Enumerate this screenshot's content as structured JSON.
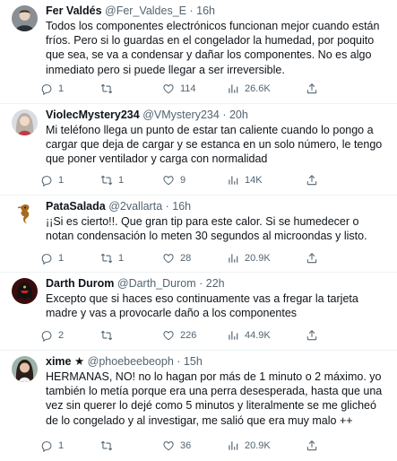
{
  "tweets": [
    {
      "name": "Fer Valdés",
      "handle": "@Fer_Valdes_E",
      "dot": "·",
      "time": "16h",
      "text": "Todos los componentes electrónicos funcionan mejor cuando están fríos. Pero si lo guardas en el congelador la humedad, por poquito que sea, se va a condensar y dañar los componentes. No es algo inmediato pero si puede llegar a ser irreversible.",
      "replies": "1",
      "retweets": "",
      "likes": "114",
      "views": "26.6K",
      "avatar_icon": "avatar-man-icon"
    },
    {
      "name": "ViolecMystery234",
      "handle": "@VMystery234",
      "dot": "·",
      "time": "20h",
      "text": "Mi teléfono llega un punto de estar tan caliente cuando lo pongo a cargar que deja de cargar y se estanca en un solo número, le tengo que poner ventilador y carga con normalidad",
      "replies": "1",
      "retweets": "1",
      "likes": "9",
      "views": "14K",
      "avatar_icon": "avatar-woman-icon"
    },
    {
      "name": "PataSalada",
      "handle": "@2vallarta",
      "dot": "·",
      "time": "16h",
      "text": "¡¡Si es cierto!!. Que gran tip para este calor. Si se humedecer o notan condensación lo meten 30 segundos al microondas y listo.",
      "replies": "1",
      "retweets": "1",
      "likes": "28",
      "views": "20.9K",
      "avatar_icon": "avatar-seahorse-icon"
    },
    {
      "name": "Darth Durom",
      "handle": "@Darth_Durom",
      "dot": "·",
      "time": "22h",
      "text": "Excepto que si haces eso continuamente vas a fregar la tarjeta madre y vas a provocarle daño a los componentes",
      "replies": "2",
      "retweets": "",
      "likes": "226",
      "views": "44.9K",
      "avatar_icon": "avatar-helmet-icon"
    },
    {
      "name": "xime ★",
      "handle": "@phoebeebeoph",
      "dot": "·",
      "time": "15h",
      "text": "HERMANAS, NO! no lo hagan por más de 1 minuto o 2 máximo. yo también lo metía porque era una perra desesperada, hasta que una vez sin querer lo dejé como 5 minutos y literalmente se me glicheó de lo congelado y al investigar, me salió que era muy malo ++",
      "replies": "1",
      "retweets": "",
      "likes": "36",
      "views": "20.9K",
      "avatar_icon": "avatar-girl-icon"
    }
  ],
  "colors": {
    "text": "#0f1419",
    "secondary": "#536471",
    "divider": "#eff3f4"
  }
}
